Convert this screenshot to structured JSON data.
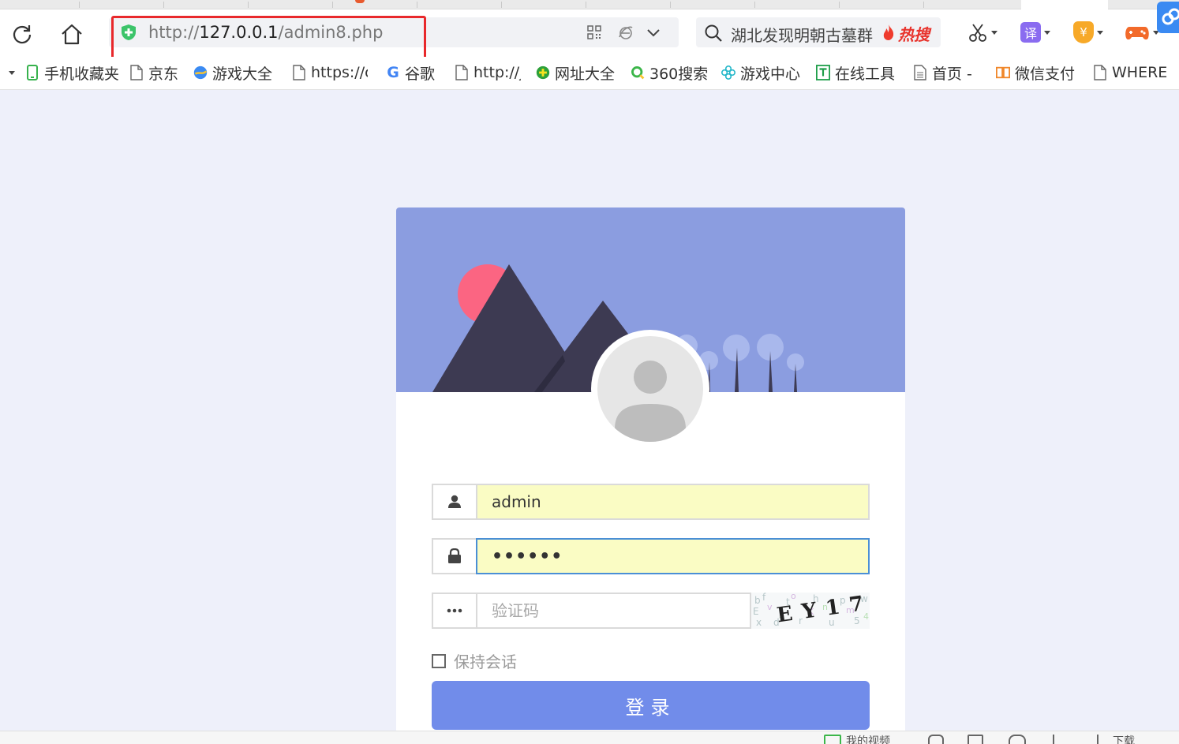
{
  "browser": {
    "address_url_prefix": "http://",
    "address_url_host": "127.0.0.1",
    "address_url_path": "/admin8.php",
    "search_query": "湖北发现明朝古墓群",
    "search_hot_badge": "热搜",
    "translate_label": "译",
    "money_label": "¥"
  },
  "bookmarks": [
    {
      "label": "手机收藏夹",
      "icon": "phone-icon"
    },
    {
      "label": "京东",
      "icon": "page-icon"
    },
    {
      "label": "游戏大全",
      "icon": "game-globe-icon"
    },
    {
      "label": "https://c",
      "icon": "page-icon"
    },
    {
      "label": "谷歌",
      "icon": "google-icon"
    },
    {
      "label": "http://j",
      "icon": "page-icon"
    },
    {
      "label": "网址大全",
      "icon": "plus-globe-icon"
    },
    {
      "label": "360搜索",
      "icon": "search-360-icon"
    },
    {
      "label": "游戏中心",
      "icon": "clover-icon"
    },
    {
      "label": "在线工具",
      "icon": "tool-icon"
    },
    {
      "label": "首页 -",
      "icon": "doc-icon"
    },
    {
      "label": "微信支付",
      "icon": "wechat-pay-icon"
    },
    {
      "label": "WHERE",
      "icon": "page-icon"
    }
  ],
  "login": {
    "username_value": "admin",
    "password_value": "••••••",
    "captcha_placeholder": "验证码",
    "captcha_text": "EY17",
    "remember_label": "保持会话",
    "submit_label": "登录"
  },
  "statusbar": {
    "item1": "我的视频",
    "item2": "下载"
  },
  "colors": {
    "banner": "#8b9de0",
    "button": "#718cea",
    "autofill": "#fafcc4",
    "highlight": "#e8282b"
  }
}
